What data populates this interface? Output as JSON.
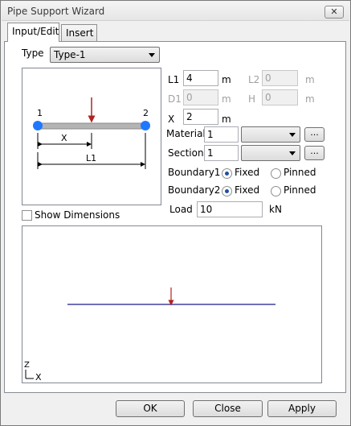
{
  "window": {
    "title": "Pipe Support Wizard",
    "close_symbol": "✕"
  },
  "tabs": [
    {
      "label": "Input/Edit"
    },
    {
      "label": "Insert"
    }
  ],
  "type": {
    "label": "Type",
    "value": "Type-1"
  },
  "sketch": {
    "node1": "1",
    "node2": "2",
    "dim_x": "X",
    "dim_l1": "L1",
    "beam_color": "#b4b4b4",
    "node_color": "#1e78ff",
    "load_color": "#b22222"
  },
  "show_dimensions": {
    "label": "Show Dimensions",
    "checked": false
  },
  "params": {
    "l1": {
      "label": "L1",
      "value": "4",
      "unit": "m"
    },
    "l2": {
      "label": "L2",
      "value": "0",
      "unit": "m"
    },
    "d1": {
      "label": "D1",
      "value": "0",
      "unit": "m"
    },
    "h": {
      "label": "H",
      "value": "0",
      "unit": "m"
    },
    "x": {
      "label": "X",
      "value": "2",
      "unit": "m"
    }
  },
  "material": {
    "label": "Material",
    "value": "1",
    "browse": "..."
  },
  "section": {
    "label": "Section",
    "value": "1",
    "browse": "..."
  },
  "boundary1": {
    "label": "Boundary1",
    "opt1": "Fixed",
    "opt2": "Pinned",
    "selected": "Fixed"
  },
  "boundary2": {
    "label": "Boundary2",
    "opt1": "Fixed",
    "opt2": "Pinned",
    "selected": "Fixed"
  },
  "load": {
    "label": "Load",
    "value": "10",
    "unit": "kN"
  },
  "canvas": {
    "axis_z": "Z",
    "axis_x": "X",
    "line_color": "#1a1a8c",
    "load_color": "#b22222"
  },
  "buttons": {
    "ok": "OK",
    "close": "Close",
    "apply": "Apply"
  }
}
